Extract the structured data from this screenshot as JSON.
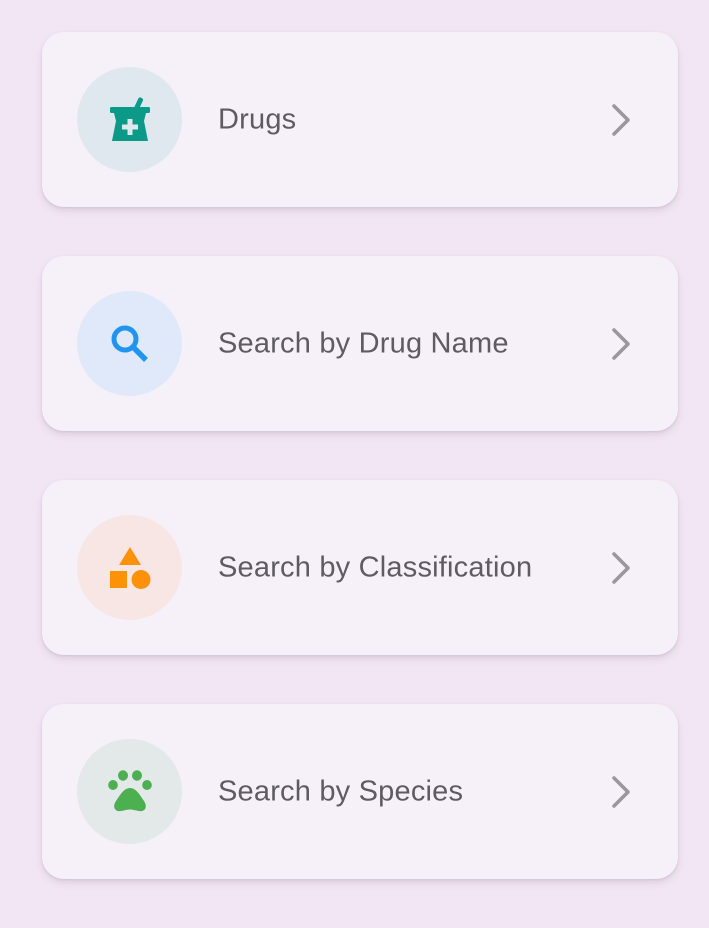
{
  "menu": {
    "items": [
      {
        "label": "Drugs",
        "icon": "mortar-pestle-icon",
        "icon_color": "#0a9a87",
        "icon_bg": "#dfe8ee"
      },
      {
        "label": "Search by Drug Name",
        "icon": "search-icon",
        "icon_color": "#2193f0",
        "icon_bg": "#e0e9f9"
      },
      {
        "label": "Search by Classification",
        "icon": "shapes-icon",
        "icon_color": "#fd9208",
        "icon_bg": "#f8e6e4"
      },
      {
        "label": "Search by Species",
        "icon": "paw-icon",
        "icon_color": "#4caf50",
        "icon_bg": "#e3e8e8"
      }
    ],
    "chevron_icon": "chevron-right-icon",
    "chevron_color": "#9a969d"
  }
}
